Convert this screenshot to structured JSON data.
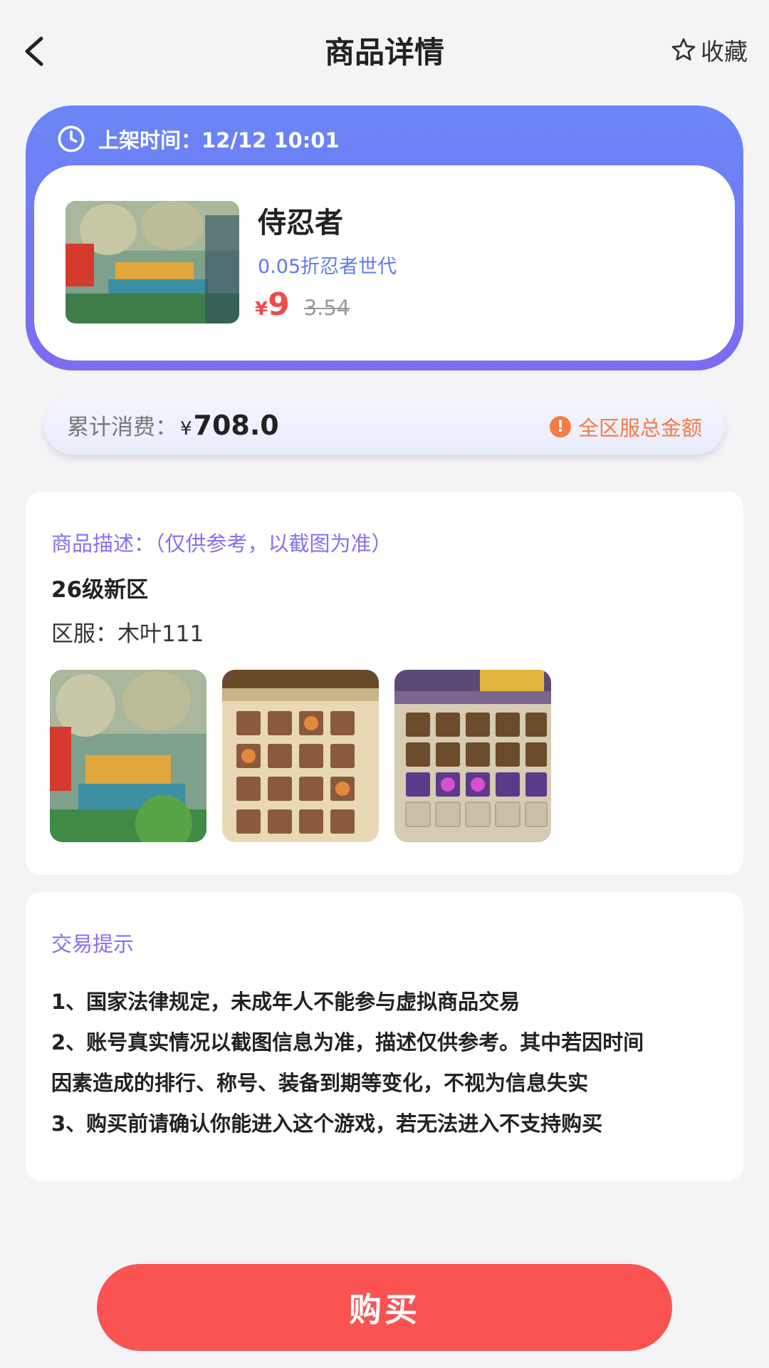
{
  "header": {
    "title": "商品详情",
    "favorite_label": "收藏"
  },
  "product": {
    "listing_time": "上架时间：12/12 10:01",
    "name": "侍忍者",
    "subtitle": "0.05折忍者世代",
    "price_symbol": "¥",
    "price": "9",
    "original_price": "3.54"
  },
  "total": {
    "label": "累计消费：",
    "symbol": "¥",
    "value": "708.0",
    "note": "全区服总金额"
  },
  "description": {
    "title": "商品描述：（仅供参考，以截图为准）",
    "level": "26级新区",
    "server": "区服：木叶111"
  },
  "tips": {
    "title": "交易提示",
    "items": [
      "1、国家法律规定，未成年人不能参与虚拟商品交易",
      "2、账号真实情况以截图信息为准，描述仅供参考。其中若因时间",
      "因素造成的排行、称号、装备到期等变化，不视为信息失实",
      "3、购买前请确认你能进入这个游戏，若无法进入不支持购买"
    ]
  },
  "buy_button": {
    "label": "购买"
  },
  "colors": {
    "accent_gradient_top": "#6a86f7",
    "accent_gradient_bottom": "#7c6cf1",
    "price_red": "#f04a4a",
    "buy_red": "#fa5352",
    "purple_title": "#8a6ef2",
    "orange_note": "#f47c46"
  }
}
